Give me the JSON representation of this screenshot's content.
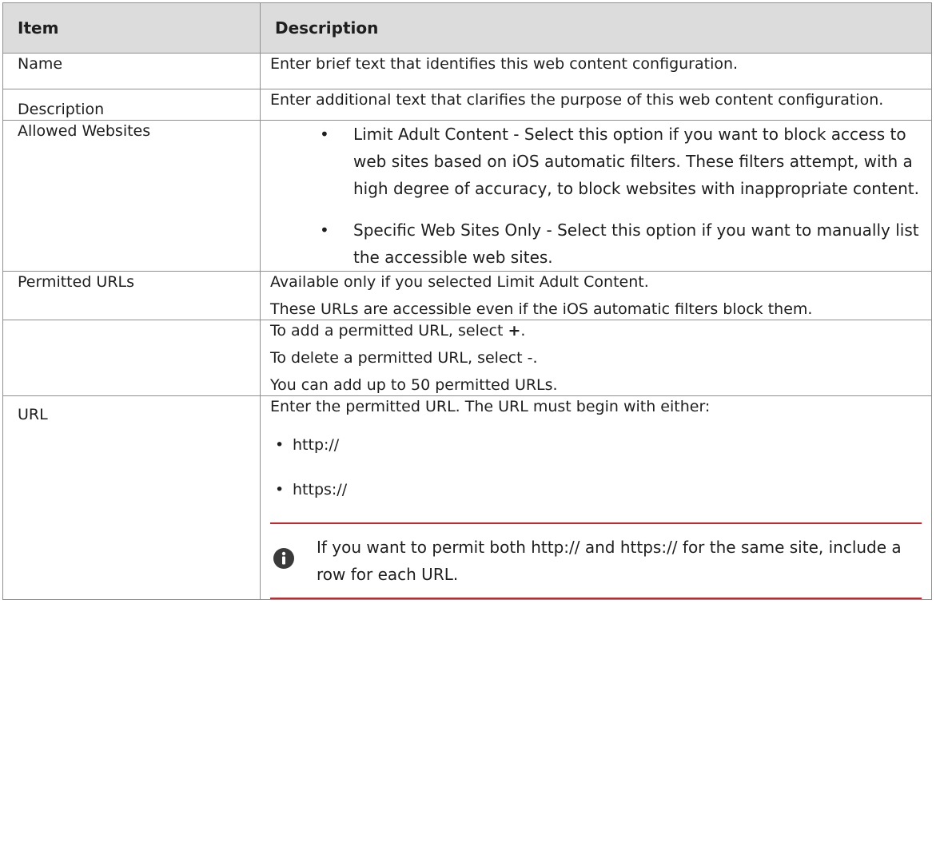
{
  "header": {
    "col_item": "Item",
    "col_description": "Description"
  },
  "rows": {
    "name": {
      "item": "Name",
      "desc": "Enter brief text that identifies this web content configuration."
    },
    "description": {
      "item": "Description",
      "desc": "Enter additional text that clarifies the purpose of this web content configuration."
    },
    "allowed": {
      "item": "Allowed Websites",
      "bullet_glyph": "•",
      "bullets": [
        "Limit Adult Content - Select this option if you want to block access to web sites based on iOS automatic filters. These filters attempt, with a high degree of accuracy, to block websites with inappropriate content.",
        "Specific Web Sites Only - Select this option if you want to manually list the accessible web sites."
      ]
    },
    "permitted": {
      "item": "Permitted URLs",
      "lines": [
        "Available only if you selected Limit Adult Content.",
        "These URLs are accessible even if the iOS automatic filters block them."
      ]
    },
    "add": {
      "item": "",
      "line1_prefix": "To add a permitted URL, select ",
      "line1_symbol": "+",
      "line1_suffix": ".",
      "line2": "To delete a permitted URL, select -.",
      "line3": "You can add up to 50 permitted URLs."
    },
    "url": {
      "item": "URL",
      "intro": "Enter the permitted URL. The URL must begin with either:",
      "bullet_glyph": "•",
      "bullets": [
        "http://",
        "https://"
      ],
      "note": {
        "icon": "info-icon",
        "text": "If you want to permit both http:// and https:// for the same site, include a row for each URL."
      }
    }
  },
  "colors": {
    "header_bg": "#dcdcdc",
    "border": "#8f8f8f",
    "note_rule": "#c8262b",
    "icon": "#3a3a3a"
  }
}
